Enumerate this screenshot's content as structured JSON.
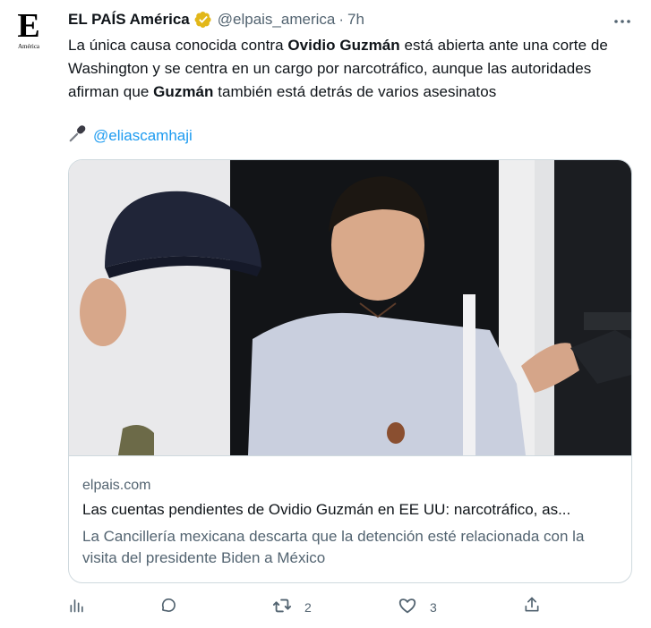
{
  "account": {
    "name": "EL PAÍS América",
    "handle": "@elpais_america",
    "separator": "·",
    "time": "7h",
    "logo_letter": "E",
    "logo_subtitle": "América"
  },
  "tweet": {
    "text_parts": {
      "p1": "La única causa conocida contra ",
      "b1": "Ovidio Guzmán",
      "p2": " está abierta ante una corte de Washington y se centra en un cargo por narcotráfico, aunque las autoridades afirman que ",
      "b2": "Guzmán",
      "p3": " también está detrás de varios asesinatos"
    },
    "credit_mention": "@eliascamhaji"
  },
  "card": {
    "domain": "elpais.com",
    "title": "Las cuentas pendientes de Ovidio Guzmán en EE UU: narcotráfico, as...",
    "description": "La Cancillería mexicana descarta que la detención esté relacionada con la visita del presidente Biden a México"
  },
  "actions": {
    "views_count": "",
    "reply_count": "",
    "retweet_count": "2",
    "like_count": "3"
  },
  "colors": {
    "accent": "#1d9bf0",
    "verified_gold": "#e2b719",
    "secondary_text": "#536471",
    "border": "#cfd9de"
  },
  "icons": [
    "verified-gold-badge",
    "more-icon",
    "microphone-icon",
    "views-icon",
    "reply-icon",
    "retweet-icon",
    "like-icon",
    "share-icon"
  ]
}
